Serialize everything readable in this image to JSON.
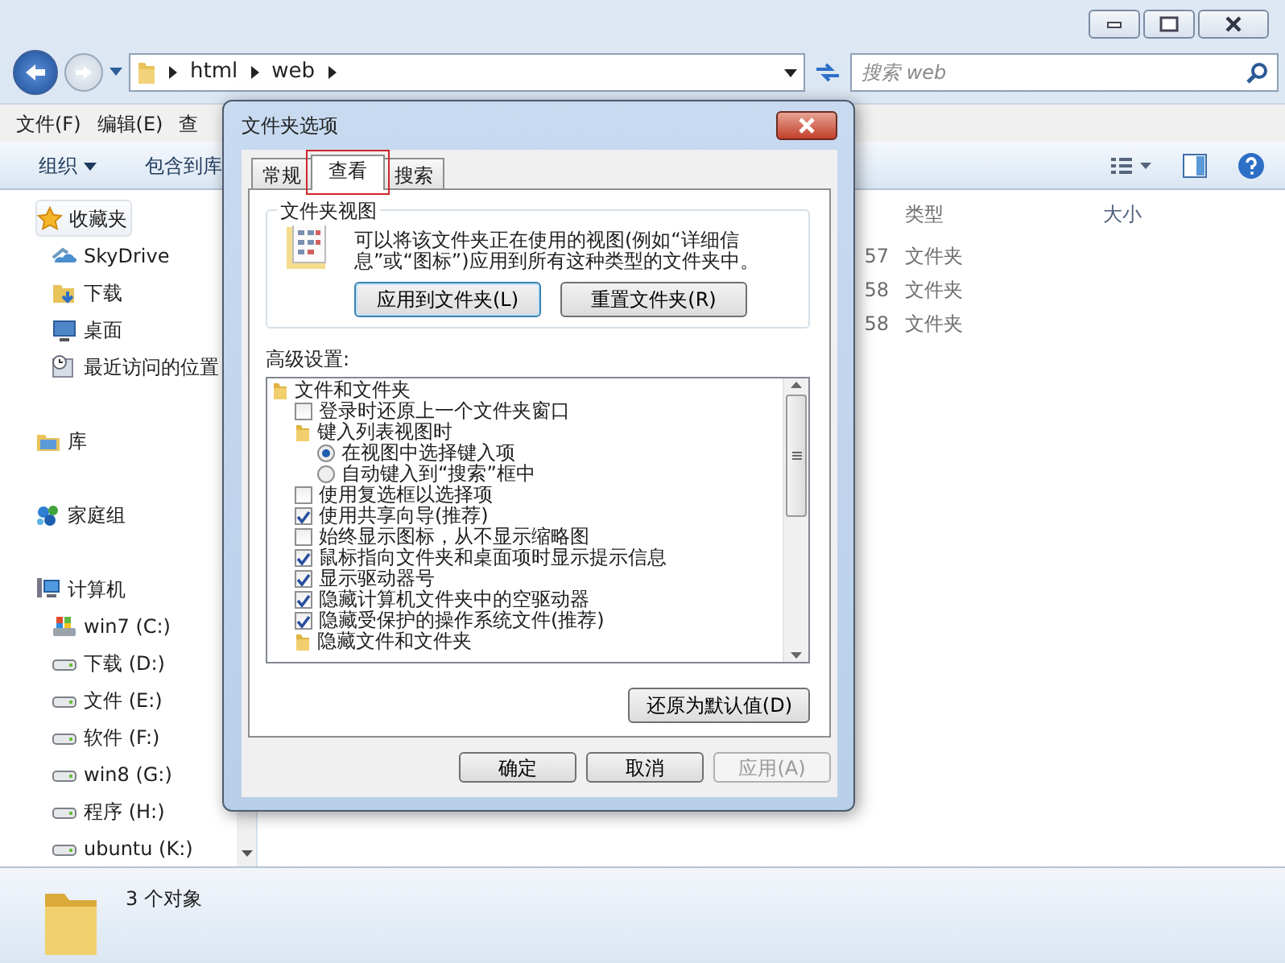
{
  "address": {
    "path": [
      "html",
      "web"
    ]
  },
  "search": {
    "placeholder": "搜索 web"
  },
  "menu": [
    "文件(F)",
    "编辑(E)",
    "查"
  ],
  "toolbar": [
    "组织",
    "包含到库"
  ],
  "sidebar": [
    {
      "label": "收藏夹",
      "kind": "star",
      "selected": true,
      "children": [
        {
          "label": "SkyDrive",
          "kind": "cloud",
          "selected": false
        },
        {
          "label": "下载",
          "kind": "download",
          "selected": false
        },
        {
          "label": "桌面",
          "kind": "desktop",
          "selected": false
        },
        {
          "label": "最近访问的位置",
          "kind": "recent",
          "selected": false
        }
      ]
    },
    {
      "label": "库",
      "kind": "library",
      "selected": false
    },
    {
      "label": "家庭组",
      "kind": "homegroup",
      "selected": false
    },
    {
      "label": "计算机",
      "kind": "computer",
      "selected": false,
      "children": [
        {
          "label": "win7 (C:)",
          "kind": "system-drive",
          "selected": false
        },
        {
          "label": "下载 (D:)",
          "kind": "drive",
          "selected": false
        },
        {
          "label": "文件 (E:)",
          "kind": "drive",
          "selected": false
        },
        {
          "label": "软件 (F:)",
          "kind": "drive",
          "selected": false
        },
        {
          "label": "win8 (G:)",
          "kind": "drive",
          "selected": false
        },
        {
          "label": "程序 (H:)",
          "kind": "drive",
          "selected": false
        },
        {
          "label": "ubuntu (K:)",
          "kind": "drive",
          "selected": false
        }
      ]
    }
  ],
  "files": {
    "columns": [
      "类型",
      "大小"
    ],
    "rows": [
      {
        "column_1": "57",
        "type": "文件夹"
      },
      {
        "column_1": "58",
        "type": "文件夹"
      },
      {
        "column_1": "58",
        "type": "文件夹"
      }
    ]
  },
  "status_bar": {
    "count": "3 个对象"
  },
  "dialog": {
    "title": "文件夹选项",
    "tabs": [
      {
        "label": "常规",
        "selected": false,
        "highlighted": false
      },
      {
        "label": "查看",
        "selected": true,
        "highlighted": true
      },
      {
        "label": "搜索",
        "selected": false,
        "highlighted": false
      }
    ],
    "folder_views": {
      "legend": "文件夹视图",
      "text": "可以将该文件夹正在使用的视图(例如“详细信息”或“图标”)应用到所有这种类型的文件夹中。",
      "buttons": [
        {
          "label": "应用到文件夹(L)",
          "default": true
        },
        {
          "label": "重置文件夹(R)",
          "default": false
        }
      ]
    },
    "advanced_label": "高级设置:",
    "settings": [
      {
        "kind": "folder",
        "label": "文件和文件夹",
        "children": [
          {
            "kind": "checkbox",
            "label": "登录时还原上一个文件夹窗口",
            "checked": false
          },
          {
            "kind": "folder",
            "label": "键入列表视图时",
            "children": [
              {
                "kind": "radio",
                "label": "在视图中选择键入项",
                "selected": true
              },
              {
                "kind": "radio",
                "label": "自动键入到“搜索”框中",
                "selected": false
              }
            ]
          },
          {
            "kind": "checkbox",
            "label": "使用复选框以选择项",
            "checked": false
          },
          {
            "kind": "checkbox",
            "label": "使用共享向导(推荐)",
            "checked": true
          },
          {
            "kind": "checkbox",
            "label": "始终显示图标，从不显示缩略图",
            "checked": false
          },
          {
            "kind": "checkbox",
            "label": "鼠标指向文件夹和桌面项时显示提示信息",
            "checked": true
          },
          {
            "kind": "checkbox",
            "label": "显示驱动器号",
            "checked": true
          },
          {
            "kind": "checkbox",
            "label": "隐藏计算机文件夹中的空驱动器",
            "checked": true
          },
          {
            "kind": "checkbox",
            "label": "隐藏受保护的操作系统文件(推荐)",
            "checked": true
          },
          {
            "kind": "folder",
            "label": "隐藏文件和文件夹"
          }
        ]
      }
    ],
    "restore_button": "还原为默认值(D)",
    "buttons": [
      {
        "label": "确定",
        "disabled": false
      },
      {
        "label": "取消",
        "disabled": false
      },
      {
        "label": "应用(A)",
        "disabled": true
      }
    ]
  }
}
